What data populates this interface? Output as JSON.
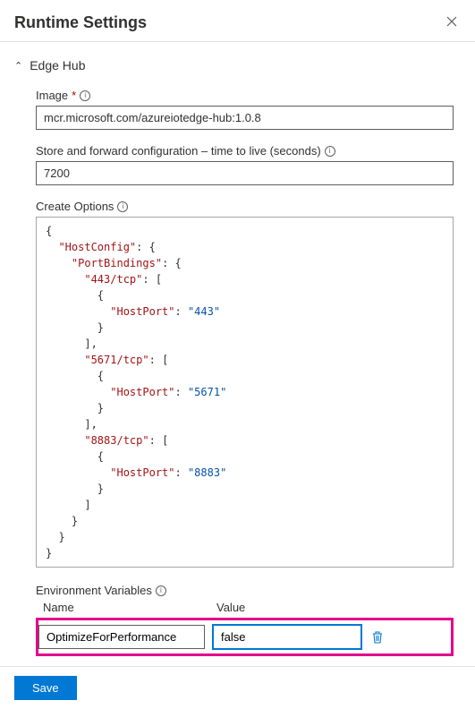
{
  "header": {
    "title": "Runtime Settings",
    "close_label": "Close"
  },
  "section": {
    "title": "Edge Hub"
  },
  "fields": {
    "image": {
      "label": "Image",
      "value": "mcr.microsoft.com/azureiotedge-hub:1.0.8"
    },
    "ttl": {
      "label": "Store and forward configuration – time to live (seconds)",
      "value": "7200"
    },
    "create_options": {
      "label": "Create Options"
    }
  },
  "create_options_json": {
    "HostConfig": {
      "PortBindings": {
        "443/tcp": [
          {
            "HostPort": "443"
          }
        ],
        "5671/tcp": [
          {
            "HostPort": "5671"
          }
        ],
        "8883/tcp": [
          {
            "HostPort": "8883"
          }
        ]
      }
    }
  },
  "env": {
    "label": "Environment Variables",
    "col_name": "Name",
    "col_value": "Value",
    "rows": [
      {
        "name": "OptimizeForPerformance",
        "value": "false"
      }
    ]
  },
  "footer": {
    "save_label": "Save"
  }
}
